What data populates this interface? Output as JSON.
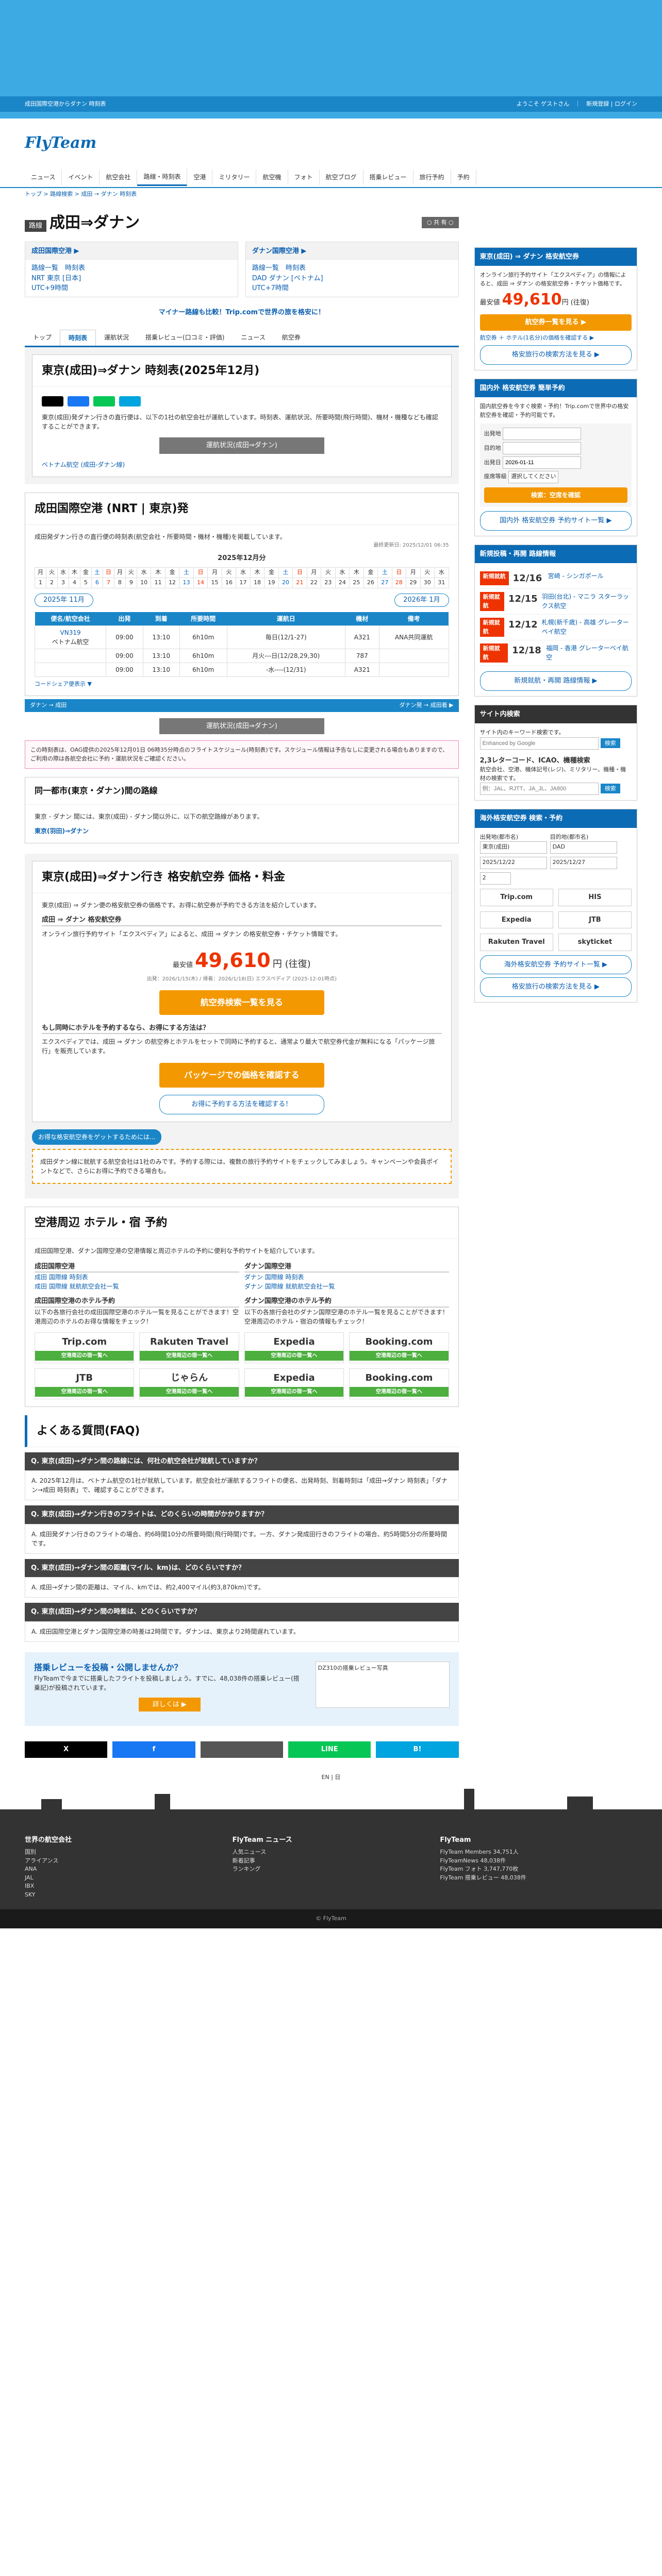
{
  "brand": {
    "top_left": "成田国際空港からダナン 時刻表",
    "top_right": "ようこそ ゲストさん　｜　新規登録 | ログイン",
    "logo": "FlyTeam"
  },
  "nav": [
    "ニュース",
    "イベント",
    "航空会社",
    "路線・時刻表",
    "空港",
    "ミリタリー",
    "航空機",
    "フォト",
    "航空ブログ",
    "搭乗レビュー",
    "旅行予約",
    "予約"
  ],
  "crumb": "トップ > 路線検索 > 成田 → ダナン 時刻表",
  "title": {
    "tag": "路線",
    "text": "成田⇒ダナン",
    "share": "○ 共 有 ○"
  },
  "airports": [
    {
      "head": "成田国際空港 ▶",
      "links": [
        "路線一覧　時刻表",
        "NRT 東京 [日本]",
        "UTC+9時間"
      ]
    },
    {
      "head": "ダナン国際空港 ▶",
      "links": [
        "路線一覧　時刻表",
        "DAD ダナン [ベトナム]",
        "UTC+7時間"
      ]
    }
  ],
  "promo": "マイナー路線も比較！Trip.comで世界の旅を格安に！",
  "tabs": [
    "トップ",
    "時刻表",
    "運航状況",
    "搭乗レビュー(口コミ・評価)",
    "ニュース",
    "航空券"
  ],
  "schedule": {
    "title": "東京(成田)⇒ダナン 時刻表(2025年12月)",
    "desc": "東京(成田)発ダナン行きの直行便は、以下の1社の航空会社が運航しています。時刻表、運航状況、所要時間(飛行時間)、機材・機種なども確認することができます。",
    "link": "ベトナム航空 (成田-ダナン線)",
    "btn": "運航状況(成田⇒ダナン)"
  },
  "nrt": {
    "title": "成田国際空港 (NRT | 東京)発",
    "desc": "成田発ダナン行きの直行便の時刻表(航空会社・所要時間・機材・機種)を掲載しています。",
    "updated": "最終更新日: 2025/12/01 06:35",
    "month": "2025年12月分",
    "prev": "2025年 11月",
    "next": "2026年 1月"
  },
  "calendar": {
    "weekdays": [
      "月",
      "火",
      "水",
      "木",
      "金",
      "土",
      "日",
      "月",
      "火",
      "水",
      "木",
      "金",
      "土",
      "日",
      "月",
      "火",
      "水",
      "木",
      "金",
      "土",
      "日",
      "月",
      "火",
      "水",
      "木",
      "金",
      "土",
      "日",
      "月",
      "火",
      "水"
    ],
    "days": [
      "1",
      "2",
      "3",
      "4",
      "5",
      "6",
      "7",
      "8",
      "9",
      "10",
      "11",
      "12",
      "13",
      "14",
      "15",
      "16",
      "17",
      "18",
      "19",
      "20",
      "21",
      "22",
      "23",
      "24",
      "25",
      "26",
      "27",
      "28",
      "29",
      "30",
      "31"
    ]
  },
  "flights": {
    "headers": [
      "便名/航空会社",
      "出発",
      "到着",
      "所要時間",
      "運航日",
      "機材",
      "備考"
    ],
    "rows": [
      {
        "no": "VN319",
        "airline": "ベトナム航空",
        "dep": "09:00",
        "arr": "13:10",
        "dur": "6h10m",
        "days": "毎日(12/1-27)",
        "eq": "A321",
        "note": "ANA共同運航"
      },
      {
        "no": "",
        "airline": "",
        "dep": "09:00",
        "arr": "13:10",
        "dur": "6h10m",
        "days": "月火---日(12/28,29,30)",
        "eq": "787",
        "note": ""
      },
      {
        "no": "",
        "airline": "",
        "dep": "09:00",
        "arr": "13:10",
        "dur": "6h10m",
        "days": "-水----(12/31)",
        "eq": "A321",
        "note": ""
      }
    ],
    "codeshare": "コードシェア便表示 ▼"
  },
  "legend": {
    "left": "ダナン → 成田",
    "right": "ダナン発 → 成田着 ▶"
  },
  "disclaimer": "この時刻表は、OAG提供の2025年12月01日 06時35分時点のフライトスケジュール(時刻表)です。スケジュール情報は予告なしに変更される場合もありますので、ご利用の際は各航空会社に予約・運航状況をご確認ください。",
  "metro": {
    "title": "同一都市(東京・ダナン)間の路線",
    "desc": "東京 - ダナン 間には、東京(成田) - ダナン間以外に、以下の航空路線があります。",
    "route": "東京(羽田)⇒ダナン"
  },
  "deals": {
    "title": "東京(成田)⇒ダナン行き 格安航空券 価格・料金",
    "desc": "東京(成田) ⇒ ダナン便の格安航空券の価格です。お得に航空券が予約できる方法を紹介しています。",
    "sub": "成田 ⇒ ダナン 格安航空券",
    "text": "オンライン旅行予約サイト「エクスペディア」によると、成田 ⇒ ダナン の格安航空券・チケット情報です。",
    "label": "最安値",
    "price": "49,610",
    "unit": "円 (往復)",
    "date": "出発：2026/1/15(木) / 帰着：2026/1/18(日) エクスペディア (2025-12-01時点)",
    "btn1": "航空券検索一覧を見る",
    "sub2": "もし同時にホテルを予約するなら、お得にする方法は？",
    "text2": "エクスペディアでは、成田 ⇒ ダナン の航空券とホテルをセットで同時に予約すると、通常より最大で航空券代金が無料になる「パッケージ旅行」を販売しています。",
    "btn2": "パッケージでの価格を確認する",
    "btn3": "お得に予約する方法を確認する！",
    "callout_title": "お得な格安航空券をゲットするためには...",
    "callout": "成田ダナン線に就航する航空会社は1社のみです。予約する際には、複数の旅行予約サイトをチェックしてみましょう。キャンペーンや会員ポイントなどで、さらにお得に予約できる場合も。"
  },
  "hotel": {
    "title": "空港周辺 ホテル・宿 予約",
    "desc": "成田国際空港、ダナン国際空港の空港情報と周辺ホテルの予約に便利な予約サイトを紹介しています。",
    "nrt_head": "成田国際空港",
    "dad_head": "ダナン国際空港",
    "nrt_links": [
      "成田 国際線 時刻表",
      "成田 国際線 就航航空会社一覧"
    ],
    "dad_links": [
      "ダナン 国際線 時刻表",
      "ダナン 国際線 就航航空会社一覧"
    ],
    "nrt_sub": "成田国際空港のホテル予約",
    "dad_sub": "ダナン国際空港のホテル予約",
    "nrt_text": "以下の各旅行会社の成田国際空港のホテル一覧を見ることができます！空港周辺のホテルのお得な情報をチェック！",
    "dad_text": "以下の各旅行会社のダナン国際空港のホテル一覧を見ることができます！空港周辺のホテル・宿泊の情報もチェック！"
  },
  "hotel_logos": [
    {
      "name": "Trip.com",
      "btn": "空港周辺の宿一覧へ"
    },
    {
      "name": "Rakuten Travel",
      "btn": "空港周辺の宿一覧へ"
    },
    {
      "name": "Expedia",
      "btn": "空港周辺の宿一覧へ"
    },
    {
      "name": "Booking.com",
      "btn": "空港周辺の宿一覧へ"
    },
    {
      "name": "JTB",
      "btn": "空港周辺の宿一覧へ"
    },
    {
      "name": "じゃらん",
      "btn": "空港周辺の宿一覧へ"
    },
    {
      "name": "Expedia",
      "btn": "空港周辺の宿一覧へ"
    },
    {
      "name": "Booking.com",
      "btn": "空港周辺の宿一覧へ"
    }
  ],
  "faq": {
    "title": "よくある質問(FAQ)",
    "items": [
      {
        "q": "Q. 東京(成田)→ダナン間の路線には、何社の航空会社が就航していますか？",
        "a": "A. 2025年12月は、ベトナム航空の1社が就航しています。航空会社が運航するフライトの便名、出発時刻、到着時刻は「成田→ダナン 時刻表」「ダナン→成田 時刻表」で、確認することができます。"
      },
      {
        "q": "Q. 東京(成田)→ダナン行きのフライトは、どのくらいの時間がかかりますか？",
        "a": "A. 成田発ダナン行きのフライトの場合、約6時間10分の所要時間(飛行時間)です。一方、ダナン発成田行きのフライトの場合、約5時間5分の所要時間です。"
      },
      {
        "q": "Q. 東京(成田)→ダナン間の距離(マイル、km)は、どのくらいですか？",
        "a": "A. 成田→ダナン間の距離は、マイル、kmでは、約2,400マイル(約3,870km)です。"
      },
      {
        "q": "Q. 東京(成田)→ダナン間の時差は、どのくらいですか？",
        "a": "A. 成田国際空港とダナン国際空港の時差は2時間です。ダナンは、東京より2時間遅れています。"
      }
    ]
  },
  "review": {
    "title": "搭乗レビューを投稿・公開しませんか？",
    "text": "FlyTeamで今までに搭乗したフライトを投稿しましょう。すでに、48,038件の搭乗レビュー(搭乗記)が投稿されています。",
    "btn": "詳しくは ▶",
    "img_alt": "DZ310の搭乗レビュー写真"
  },
  "share_bar": [
    "X",
    "f",
    "",
    "LINE",
    "B!"
  ],
  "side": {
    "ad_title": "東京(成田) ⇒ ダナン 格安航空券",
    "ad_text": "オンライン旅行予約サイト「エクスペディア」の情報によると、成田 ⇒ ダナン の格安航空券・チケット価格です。",
    "ad_label": "最安値",
    "ad_price": "49,610",
    "ad_unit": "円 (往復)",
    "ad_btn1": "航空券一覧を見る ▶",
    "ad_btn2": "航空券 ＋ ホテル(1名分)の価格を確認する ▶",
    "ad_btn3": "格安旅行の検索方法を見る ▶",
    "trip_title": "国内外 格安航空券 簡単予約",
    "trip_text": "国内航空券を今すぐ検索・予約！Trip.comで世界中の格安航空券を確認・予約可能です。",
    "trip_from_label": "出発地",
    "trip_to_label": "目的地",
    "trip_date_label": "出発日",
    "trip_date": "2026-01-11",
    "trip_class_label": "座席等級",
    "trip_class": "選択してください",
    "trip_btn": "検索：空席を確認",
    "trip_btn2": "国内外 格安航空券 予約サイト一覧 ▶",
    "news_title": "新規投稿・再開 路線情報",
    "news": [
      {
        "badge": "新規就航",
        "time": "12/16",
        "text": "宮崎 - シンガポール"
      },
      {
        "badge": "新規就航",
        "time": "12/15",
        "text": "羽田(台北) - マニラ スターラックス航空"
      },
      {
        "badge": "新規就航",
        "time": "12/12",
        "text": "札幌(新千歳) - 高雄 グレーターベイ航空"
      },
      {
        "badge": "新規就航",
        "time": "12/18",
        "text": "福岡 - 香港 グレーターベイ航空"
      }
    ],
    "news_btn": "新規就航・再開 路線情報 ▶",
    "search_title": "サイト内検索",
    "search_label": "サイト内のキーワード検索です。",
    "search_ph": "Enhanced by Google",
    "search_btn": "検索",
    "code_title": "2,3レターコード、ICAO、機種検索",
    "code_text": "航空会社、空港、機体記号(レジ)、ミリタリー、機種・機材の検索です。",
    "code_ph": "例：JAL、RJTT、JA_JL、JA800",
    "code_btn": "検索",
    "hotel_title": "海外格安航空券 検索・予約",
    "h_dep_label": "出発地(都市名)",
    "h_dep": "東京(成田)",
    "h_arr_label": "目的地(都市名)",
    "h_arr": "DAD",
    "h_go": "2025/12/22",
    "h_ret": "2025/12/27",
    "h_adult": "2",
    "h_links": [
      "Trip.com",
      "HIS",
      "Expedia",
      "JTB",
      "Rakuten Travel",
      "skyticket"
    ],
    "h_btn": "海外格安航空券 予約サイト一覧 ▶",
    "h_btn2": "格安旅行の検索方法を見る ▶"
  },
  "footer": {
    "cols": [
      {
        "t": "世界の航空会社",
        "items": [
          "国別",
          "アライアンス",
          "ANA",
          "JAL",
          "IBX",
          "SKY"
        ]
      },
      {
        "t": "FlyTeam ニュース",
        "items": [
          "人気ニュース",
          "新着記事",
          "ランキング"
        ]
      },
      {
        "t": "FlyTeam",
        "items": [
          "FlyTeam Members 34,751人",
          "FlyTeamNews 48,038件",
          "FlyTeam フォト 3,747,770枚",
          "FlyTeam 搭乗レビュー 48,038件"
        ]
      }
    ],
    "copy": "© FlyTeam"
  },
  "lang": "EN | 日"
}
